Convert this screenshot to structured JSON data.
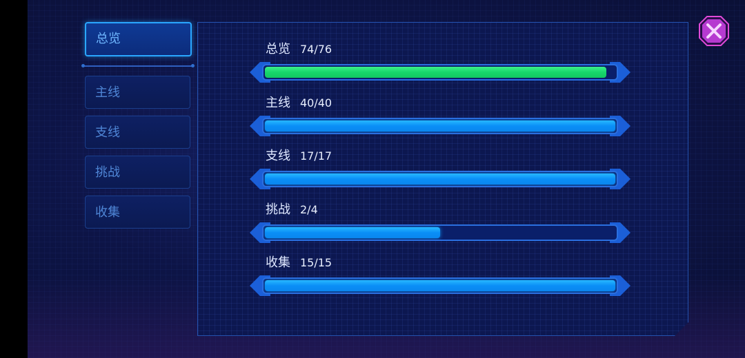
{
  "tabs": [
    {
      "label": "总览",
      "active": true
    },
    {
      "label": "主线",
      "active": false
    },
    {
      "label": "支线",
      "active": false
    },
    {
      "label": "挑战",
      "active": false
    },
    {
      "label": "收集",
      "active": false
    }
  ],
  "progress": [
    {
      "label": "总览",
      "count": "74/76",
      "value": 74,
      "max": 76,
      "color": "#17d66b"
    },
    {
      "label": "主线",
      "count": "40/40",
      "value": 40,
      "max": 40,
      "color": "#0a8ff7"
    },
    {
      "label": "支线",
      "count": "17/17",
      "value": 17,
      "max": 17,
      "color": "#0a8ff7"
    },
    {
      "label": "挑战",
      "count": "2/4",
      "value": 2,
      "max": 4,
      "color": "#0a8ff7"
    },
    {
      "label": "收集",
      "count": "15/15",
      "value": 15,
      "max": 15,
      "color": "#0a8ff7"
    }
  ],
  "close_icon": "close-icon",
  "colors": {
    "accent": "#2aa7ff",
    "close": "#e04ad8"
  }
}
